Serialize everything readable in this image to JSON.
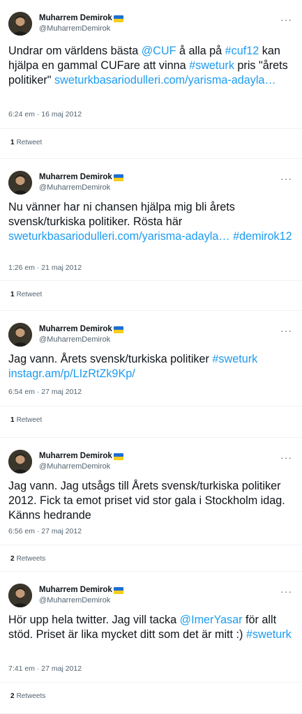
{
  "tweets": [
    {
      "name": "Muharrem Demirok",
      "handle": "@MuharremDemirok",
      "parts": [
        {
          "t": "Undrar om världens bästa ",
          "link": false
        },
        {
          "t": "@CUF",
          "link": true
        },
        {
          "t": " å alla på ",
          "link": false
        },
        {
          "t": "#cuf12",
          "link": true
        },
        {
          "t": " kan hjälpa en gammal CUFare att vinna ",
          "link": false
        },
        {
          "t": "#sweturk",
          "link": true
        },
        {
          "t": " pris \"årets politiker\" ",
          "link": false
        },
        {
          "t": "sweturkbasariodulleri.com/yarisma-adayla…",
          "link": true
        }
      ],
      "time": "6:24 em · 16 maj 2012",
      "count": "1",
      "count_label": "Retweet"
    },
    {
      "name": "Muharrem Demirok",
      "handle": "@MuharremDemirok",
      "parts": [
        {
          "t": "Nu vänner har ni chansen hjälpa mig bli årets svensk/turkiska politiker. Rösta här ",
          "link": false
        },
        {
          "t": "sweturkbasariodulleri.com/yarisma-adayla…",
          "link": true
        },
        {
          "t": " ",
          "link": false
        },
        {
          "t": "#demirok12",
          "link": true
        }
      ],
      "time": "1:26 em · 21 maj 2012",
      "count": "1",
      "count_label": "Retweet"
    },
    {
      "name": "Muharrem Demirok",
      "handle": "@MuharremDemirok",
      "parts": [
        {
          "t": "Jag vann. Årets svensk/turkiska politiker ",
          "link": false
        },
        {
          "t": "#sweturk",
          "link": true
        },
        {
          "t": " ",
          "link": false
        },
        {
          "t": "instagr.am/p/LIzRtZk9Kp/",
          "link": true
        }
      ],
      "time": "6:54 em · 27 maj 2012",
      "count": "1",
      "count_label": "Retweet"
    },
    {
      "name": "Muharrem Demirok",
      "handle": "@MuharremDemirok",
      "parts": [
        {
          "t": "Jag vann. Jag utsågs till Årets svensk/turkiska politiker 2012. Fick ta emot priset vid stor gala i Stockholm idag. Känns hedrande",
          "link": false
        }
      ],
      "time": "6:56 em · 27 maj 2012",
      "count": "2",
      "count_label": "Retweets"
    },
    {
      "name": "Muharrem Demirok",
      "handle": "@MuharremDemirok",
      "parts": [
        {
          "t": "Hör upp hela twitter. Jag vill tacka ",
          "link": false
        },
        {
          "t": "@ImerYasar",
          "link": true
        },
        {
          "t": " för allt stöd. Priset är lika mycket ditt som det är mitt :) ",
          "link": false
        },
        {
          "t": "#sweturk",
          "link": true
        }
      ],
      "time": "7:41 em · 27 maj 2012",
      "count": "2",
      "count_label": "Retweets"
    }
  ],
  "more_glyph": "···"
}
